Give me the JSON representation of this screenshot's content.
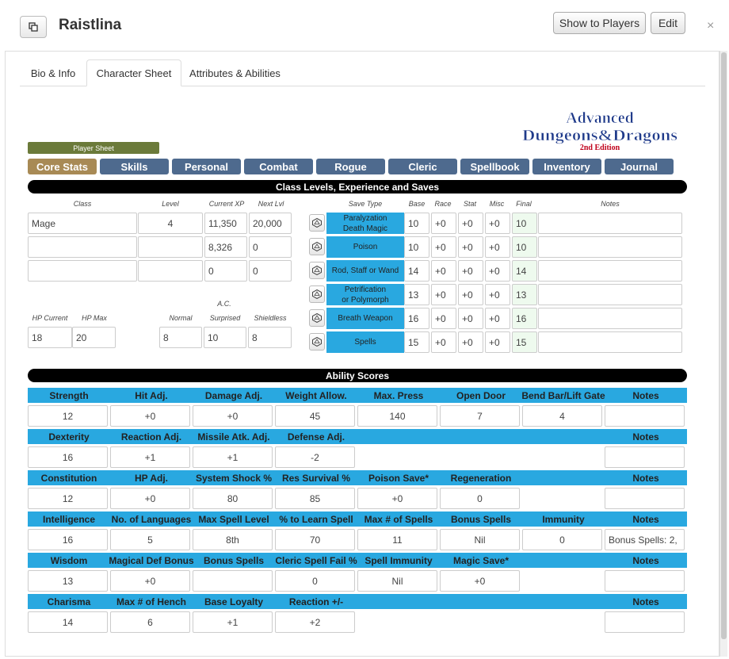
{
  "header": {
    "character_name": "Raistlina",
    "show_to_players_label": "Show to Players",
    "edit_label": "Edit",
    "close_glyph": "×"
  },
  "tabs": [
    {
      "label": "Bio & Info"
    },
    {
      "label": "Character Sheet"
    },
    {
      "label": "Attributes & Abilities"
    }
  ],
  "logo": {
    "line1": "Advanced",
    "line2": "Dungeons&Dragons",
    "line3": "2nd Edition"
  },
  "player_sheet_label": "Player Sheet",
  "nav": [
    {
      "label": "Core Stats"
    },
    {
      "label": "Skills"
    },
    {
      "label": "Personal"
    },
    {
      "label": "Combat"
    },
    {
      "label": "Rogue"
    },
    {
      "label": "Cleric"
    },
    {
      "label": "Spellbook"
    },
    {
      "label": "Inventory"
    },
    {
      "label": "Journal"
    }
  ],
  "class_section": {
    "title": "Class Levels, Experience and Saves",
    "labels": {
      "class": "Class",
      "level": "Level",
      "current_xp": "Current XP",
      "next_lvl": "Next Lvl",
      "hp_current": "HP Current",
      "hp_max": "HP Max",
      "ac": "A.C.",
      "normal": "Normal",
      "surprised": "Surprised",
      "shieldless": "Shieldless"
    },
    "rows": [
      {
        "class": "Mage",
        "level": "4",
        "xp": "11,350",
        "next": "20,000"
      },
      {
        "class": "",
        "level": "",
        "xp": "8,326",
        "next": "0"
      },
      {
        "class": "",
        "level": "",
        "xp": "0",
        "next": "0"
      }
    ],
    "hp_current": "18",
    "hp_max": "20",
    "ac_normal": "8",
    "ac_surprised": "10",
    "ac_shieldless": "8"
  },
  "saves": {
    "labels": {
      "save_type": "Save Type",
      "base": "Base",
      "race": "Race",
      "stat": "Stat",
      "misc": "Misc",
      "final": "Final",
      "notes": "Notes"
    },
    "rows": [
      {
        "type": "Paralyzation\nDeath Magic",
        "base": "10",
        "race": "+0",
        "stat": "+0",
        "misc": "+0",
        "final": "10",
        "notes": ""
      },
      {
        "type": "Poison",
        "base": "10",
        "race": "+0",
        "stat": "+0",
        "misc": "+0",
        "final": "10",
        "notes": ""
      },
      {
        "type": "Rod, Staff or Wand",
        "base": "14",
        "race": "+0",
        "stat": "+0",
        "misc": "+0",
        "final": "14",
        "notes": ""
      },
      {
        "type": "Petrification\nor Polymorph",
        "base": "13",
        "race": "+0",
        "stat": "+0",
        "misc": "+0",
        "final": "13",
        "notes": ""
      },
      {
        "type": "Breath Weapon",
        "base": "16",
        "race": "+0",
        "stat": "+0",
        "misc": "+0",
        "final": "16",
        "notes": ""
      },
      {
        "type": "Spells",
        "base": "15",
        "race": "+0",
        "stat": "+0",
        "misc": "+0",
        "final": "15",
        "notes": ""
      }
    ]
  },
  "ability_section": {
    "title": "Ability Scores",
    "rows": [
      {
        "headers": [
          "Strength",
          "Hit Adj.",
          "Damage Adj.",
          "Weight Allow.",
          "Max. Press",
          "Open Door",
          "Bend Bar/Lift Gate",
          "Notes"
        ],
        "values": [
          "12",
          "+0",
          "+0",
          "45",
          "140",
          "7",
          "4",
          ""
        ]
      },
      {
        "headers": [
          "Dexterity",
          "Reaction Adj.",
          "Missile Atk. Adj.",
          "Defense Adj.",
          "",
          "",
          "",
          "Notes"
        ],
        "values": [
          "16",
          "+1",
          "+1",
          "-2",
          null,
          null,
          null,
          ""
        ]
      },
      {
        "headers": [
          "Constitution",
          "HP Adj.",
          "System Shock %",
          "Res Survival %",
          "Poison Save*",
          "Regeneration",
          "",
          "Notes"
        ],
        "values": [
          "12",
          "+0",
          "80",
          "85",
          "+0",
          "0",
          null,
          ""
        ]
      },
      {
        "headers": [
          "Intelligence",
          "No. of Languages",
          "Max Spell Level",
          "% to Learn Spell",
          "Max # of Spells",
          "Bonus Spells",
          "Immunity",
          "Notes"
        ],
        "values": [
          "16",
          "5",
          "8th",
          "70",
          "11",
          "Nil",
          "0",
          "Bonus Spells: 2,"
        ]
      },
      {
        "headers": [
          "Wisdom",
          "Magical Def Bonus",
          "Bonus Spells",
          "Cleric Spell Fail %",
          "Spell Immunity",
          "Magic Save*",
          "",
          "Notes"
        ],
        "values": [
          "13",
          "+0",
          "",
          "0",
          "Nil",
          "+0",
          null,
          ""
        ]
      },
      {
        "headers": [
          "Charisma",
          "Max # of Hench",
          "Base Loyalty",
          "Reaction +/-",
          "",
          "",
          "",
          "Notes"
        ],
        "values": [
          "14",
          "6",
          "+1",
          "+2",
          null,
          null,
          null,
          ""
        ]
      }
    ]
  }
}
